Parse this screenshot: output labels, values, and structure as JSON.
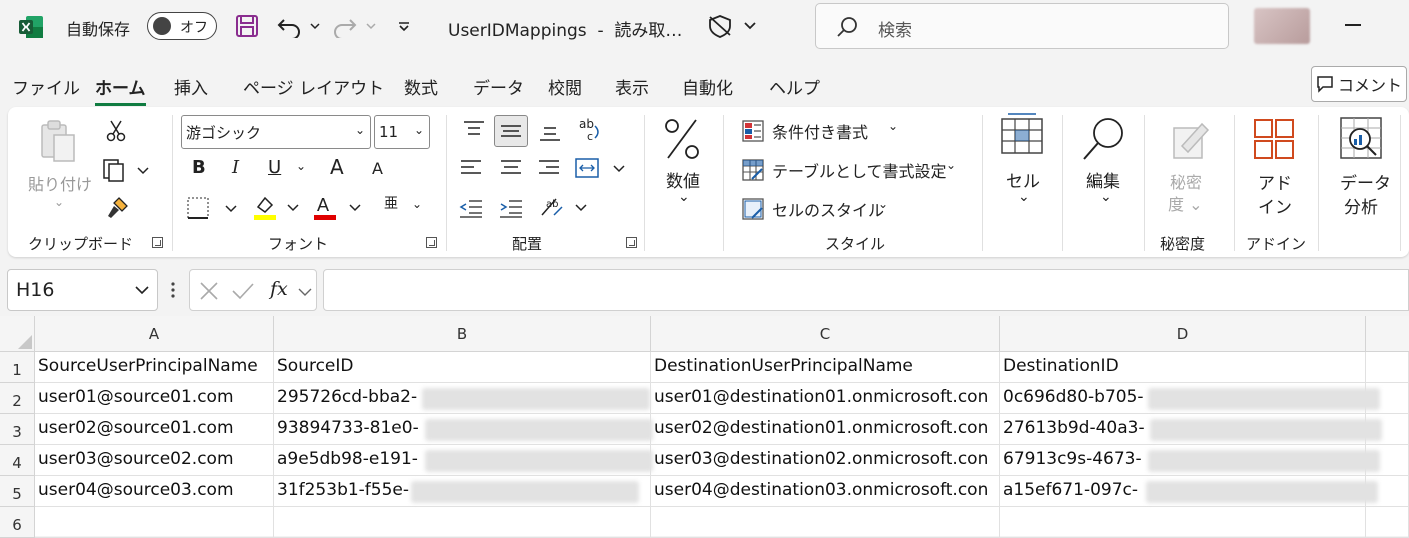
{
  "titlebar": {
    "autosave_label": "自動保存",
    "autosave_state": "オフ",
    "document_title": "UserIDMappings",
    "document_status": "読み取…",
    "search_placeholder": "検索"
  },
  "menu": {
    "items": [
      "ファイル",
      "ホーム",
      "挿入",
      "ページ レイアウト",
      "数式",
      "データ",
      "校閲",
      "表示",
      "自動化",
      "ヘルプ"
    ],
    "active": "ホーム",
    "comment_label": "コメント"
  },
  "ribbon": {
    "clipboard": {
      "paste_label": "貼り付け",
      "group_label": "クリップボード"
    },
    "font": {
      "font_name": "游ゴシック",
      "font_size": "11",
      "group_label": "フォント",
      "bold": "B",
      "italic": "I",
      "underline": "U",
      "grow": "A",
      "shrink": "A",
      "phonetic": "亜"
    },
    "alignment": {
      "group_label": "配置"
    },
    "number": {
      "label": "数値"
    },
    "styles": {
      "conditional": "条件付き書式",
      "table": "テーブルとして書式設定",
      "cell_styles": "セルのスタイル",
      "group_label": "スタイル"
    },
    "cells": {
      "label": "セル"
    },
    "editing": {
      "label": "編集"
    },
    "sensitivity": {
      "label_line1": "秘密",
      "label_line2": "度",
      "group_label": "秘密度"
    },
    "addins": {
      "label_line1": "アド",
      "label_line2": "イン",
      "group_label": "アドイン"
    },
    "analysis": {
      "label_line1": "データ",
      "label_line2": "分析"
    }
  },
  "formula_bar": {
    "name_box": "H16",
    "fx": "fx",
    "formula": ""
  },
  "sheet": {
    "columns": [
      "A",
      "B",
      "C",
      "D"
    ],
    "row_numbers": [
      "1",
      "2",
      "3",
      "4",
      "5",
      "6"
    ],
    "rows": [
      [
        "SourceUserPrincipalName",
        "SourceID",
        "DestinationUserPrincipalName",
        "DestinationID"
      ],
      [
        "user01@source01.com",
        "295726cd-bba2-",
        "user01@destination01.onmicrosoft.con",
        "0c696d80-b705-"
      ],
      [
        "user02@source01.com",
        "93894733-81e0-",
        "user02@destination01.onmicrosoft.con",
        "27613b9d-40a3-"
      ],
      [
        "user03@source02.com",
        "a9e5db98-e191-",
        "user03@destination02.onmicrosoft.con",
        "67913c9s-4673-"
      ],
      [
        "user04@source03.com",
        "31f253b1-f55e-",
        "user04@destination03.onmicrosoft.con",
        "a15ef671-097c-"
      ],
      [
        "",
        "",
        "",
        ""
      ]
    ]
  },
  "colors": {
    "excel_green": "#107c41",
    "save_purple": "#8a2d8f",
    "highlight_yellow": "#ffff00",
    "font_red": "#e00000",
    "addin_orange": "#d04a1e"
  }
}
